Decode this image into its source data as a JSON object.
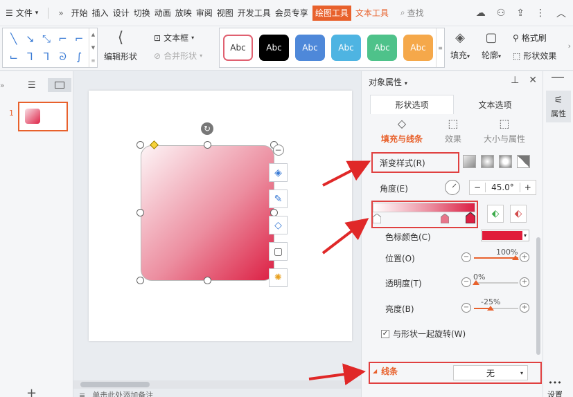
{
  "menubar": {
    "menu_icon": "hamburger-icon",
    "file_label": "文件",
    "more_label": "»",
    "tabs": [
      "开始",
      "插入",
      "设计",
      "切换",
      "动画",
      "放映",
      "审阅",
      "视图",
      "开发工具",
      "会员专享",
      "绘图工具",
      "文本工具"
    ],
    "active_tab": "绘图工具",
    "search_label": "查找"
  },
  "ribbon": {
    "edit_shape_label": "编辑形状",
    "textbox_label": "文本框",
    "merge_shape_label": "合并形状",
    "style_labels": [
      "Abc",
      "Abc",
      "Abc",
      "Abc",
      "Abc",
      "Abc"
    ],
    "style_colors": [
      "#ffffff",
      "#000000",
      "#4e88d9",
      "#4eb4e2",
      "#4ec28a",
      "#f5a84a"
    ],
    "fill_label": "填充",
    "outline_label": "轮廓",
    "format_painter_label": "格式刷",
    "shape_effect_label": "形状效果"
  },
  "thumbnails": {
    "slide_number": "1"
  },
  "props": {
    "title": "对象属性",
    "tabs": [
      "形状选项",
      "文本选项"
    ],
    "subtabs": [
      "填充与线条",
      "效果",
      "大小与属性"
    ],
    "gradient_style_label": "渐变样式(R)",
    "angle_label": "角度(E)",
    "angle_value": "45.0°",
    "stop_color_label": "色标颜色(C)",
    "stop_color": "#e01c3a",
    "position_label": "位置(O)",
    "position_value": "100%",
    "transparency_label": "透明度(T)",
    "transparency_value": "0%",
    "brightness_label": "亮度(B)",
    "brightness_value": "-25%",
    "rotate_with_shape_label": "与形状一起旋转(W)",
    "line_label": "线条",
    "line_value": "无"
  },
  "sidebar": {
    "properties_label": "属性",
    "settings_label": "设置"
  },
  "notes": {
    "placeholder": "单击此处添加备注"
  }
}
